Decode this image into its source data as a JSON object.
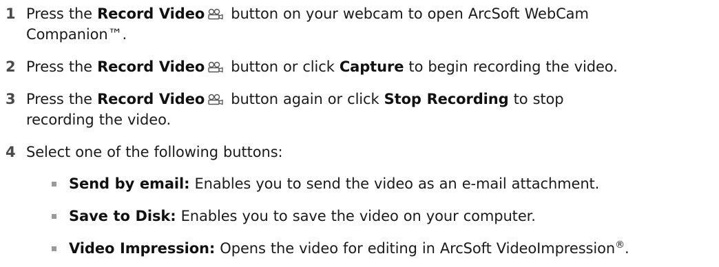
{
  "steps": [
    {
      "number": "1",
      "pre": "Press the ",
      "bold1": "Record Video",
      "mid": " button on your webcam to open ArcSoft WebCam",
      "line2": "Companion™."
    },
    {
      "number": "2",
      "pre": "Press the ",
      "bold1": "Record Video",
      "mid": " button or click ",
      "bold2": "Capture",
      "post": " to begin recording the video."
    },
    {
      "number": "3",
      "pre": "Press the ",
      "bold1": "Record Video",
      "mid": " button again or click ",
      "bold2": "Stop Recording",
      "post": " to stop",
      "line2": "recording the video."
    },
    {
      "number": "4",
      "text": "Select one of the following buttons:"
    }
  ],
  "bullets": [
    {
      "term": "Send by email:",
      "desc": " Enables you to send the video as an e-mail attachment."
    },
    {
      "term": "Save to Disk:",
      "desc": " Enables you to save the video on your computer."
    },
    {
      "term": "Video Impression:",
      "desc": " Opens the video for editing in ArcSoft VideoImpression",
      "sup": "®",
      "end": "."
    }
  ],
  "icons": {
    "record_video": "video-camera-icon"
  },
  "colors": {
    "text": "#1a1a1a",
    "step_number": "#4a4a4a",
    "bullet": "#9a9a9a"
  }
}
